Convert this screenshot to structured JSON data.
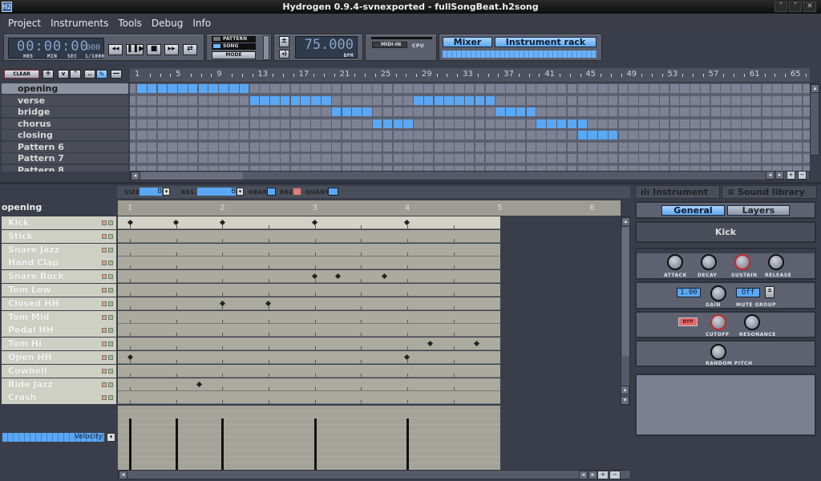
{
  "window": {
    "title": "Hydrogen 0.9.4-svnexported - fullSongBeat.h2song",
    "app_icon": "H2",
    "controls": [
      "minimize-icon",
      "maximize-icon",
      "close-icon"
    ]
  },
  "menu": [
    "Project",
    "Instruments",
    "Tools",
    "Debug",
    "Info"
  ],
  "transport": {
    "time": "00:00:00",
    "ms": "000",
    "labels": [
      "HRS",
      "MIN",
      "SEC",
      "1/1000"
    ],
    "buttons": [
      "rewind-icon",
      "play-pause-icon",
      "stop-icon",
      "fast-forward-icon",
      "loop-icon"
    ]
  },
  "mode": {
    "pattern": "PATTERN",
    "song": "SONG",
    "mode_btn": "MODE",
    "active": "song"
  },
  "bpm": {
    "value": "75.000",
    "label": "BPM"
  },
  "midi": {
    "midi_in": "MIDI-IN",
    "cpu": "CPU"
  },
  "rack": {
    "mixer": "Mixer",
    "instrument_rack": "Instrument rack"
  },
  "song_editor": {
    "toolbar": {
      "clear": "CLEAR"
    },
    "ruler": [
      "1",
      "5",
      "9",
      "13",
      "17",
      "21",
      "25",
      "29",
      "33",
      "37",
      "41",
      "45",
      "49",
      "53",
      "57",
      "61",
      "65"
    ],
    "patterns": [
      {
        "name": "opening",
        "selected": true,
        "bars": [
          [
            1,
            11
          ]
        ]
      },
      {
        "name": "verse",
        "bars": [
          [
            12,
            19
          ],
          [
            28,
            35
          ]
        ]
      },
      {
        "name": "bridge",
        "bars": [
          [
            20,
            23
          ],
          [
            36,
            39
          ]
        ]
      },
      {
        "name": "chorus",
        "bars": [
          [
            24,
            27
          ],
          [
            40,
            44
          ]
        ]
      },
      {
        "name": "closing",
        "bars": [
          [
            44,
            47
          ]
        ]
      },
      {
        "name": "Pattern 6",
        "bars": []
      },
      {
        "name": "Pattern 7",
        "bars": []
      },
      {
        "name": "Pattern 8",
        "bars": []
      }
    ],
    "accent": "#5aa8f5"
  },
  "pattern_editor": {
    "size_label": "SIZE",
    "size": "8",
    "res_label": "RES.",
    "res": "8",
    "hear": "HEAR",
    "rec": "REC",
    "quant": "QUANT",
    "pattern_name": "opening",
    "ruler": [
      "1",
      "2",
      "3",
      "4",
      "5",
      "6"
    ],
    "instruments": [
      {
        "name": "Kick",
        "notes": [
          0,
          0.5,
          1,
          2,
          3
        ]
      },
      {
        "name": "Stick",
        "notes": []
      },
      {
        "name": "Snare Jazz",
        "notes": []
      },
      {
        "name": "Hand Clap",
        "notes": []
      },
      {
        "name": "Snare Rock",
        "notes": [
          2,
          2.25,
          2.75
        ]
      },
      {
        "name": "Tom Low",
        "notes": []
      },
      {
        "name": "Closed HH",
        "notes": [
          1,
          1.5
        ]
      },
      {
        "name": "Tom Mid",
        "notes": []
      },
      {
        "name": "Pedal HH",
        "notes": []
      },
      {
        "name": "Tom Hi",
        "notes": [
          3.25,
          3.75
        ]
      },
      {
        "name": "Open HH",
        "notes": [
          0,
          3
        ]
      },
      {
        "name": "Cowbell",
        "notes": []
      },
      {
        "name": "Ride Jazz",
        "notes": [
          0.75
        ]
      },
      {
        "name": "Crash",
        "notes": []
      }
    ],
    "property": "Velocity",
    "velocity": [
      1,
      1,
      1,
      1,
      1
    ]
  },
  "instrument_panel": {
    "tabs": [
      "Instrument",
      "Sound library"
    ],
    "subtabs": [
      "General",
      "Layers"
    ],
    "name": "Kick",
    "adsr": [
      "ATTACK",
      "DECAY",
      "SUSTAIN",
      "RELEASE"
    ],
    "gain_value": "1.00",
    "gain": "GAIN",
    "mute_group_value": "Off",
    "mute_group": "MUTE GROUP",
    "bypass": "BYP",
    "cutoff": "CUTOFF",
    "resonance": "RESONANCE",
    "random_pitch": "RANDOM PITCH"
  }
}
